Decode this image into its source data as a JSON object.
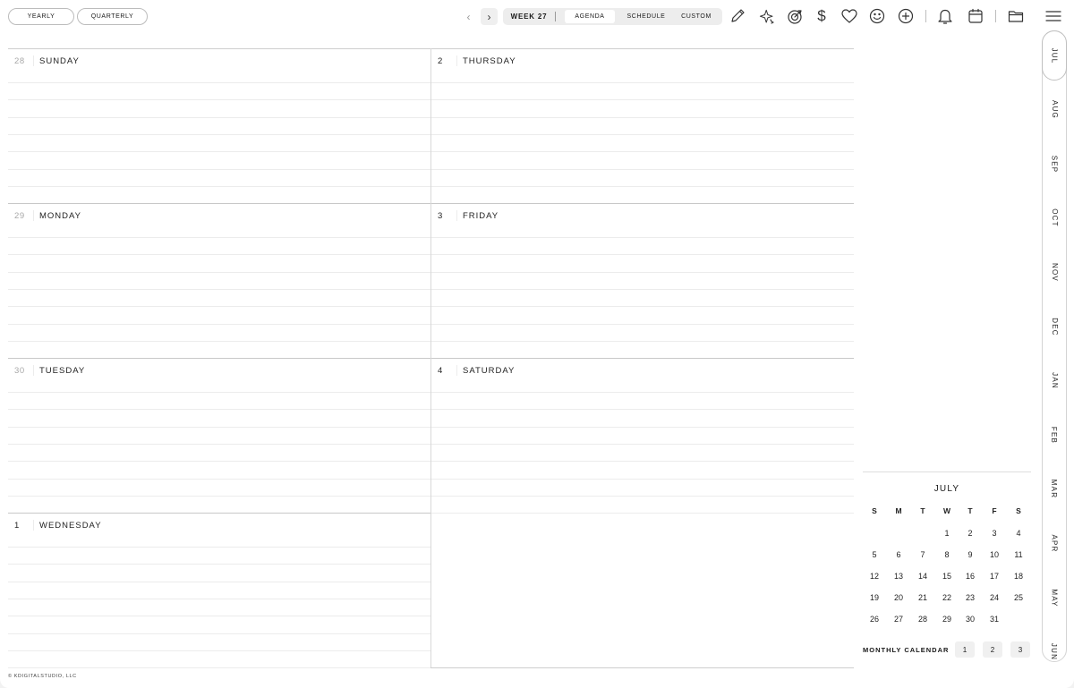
{
  "top_bar": {
    "yearly": "YEARLY",
    "quarterly": "QUARTERLY",
    "prev": "‹",
    "next": "›",
    "week": "WEEK 27",
    "views": [
      "AGENDA",
      "SCHEDULE",
      "CUSTOM"
    ],
    "active_view": "AGENDA",
    "icons": [
      "pencil-icon",
      "sparkle-icon",
      "target-icon",
      "dollar-icon",
      "heart-icon",
      "smiley-icon",
      "plus-circle-icon",
      "bell-icon",
      "calendar-icon",
      "folder-icon",
      "menu-icon"
    ],
    "dollar_glyph": "$"
  },
  "days": [
    {
      "num": "28",
      "name": "SUNDAY",
      "muted": true
    },
    {
      "num": "29",
      "name": "MONDAY",
      "muted": true
    },
    {
      "num": "30",
      "name": "TUESDAY",
      "muted": true
    },
    {
      "num": "1",
      "name": "WEDNESDAY",
      "muted": false
    },
    {
      "num": "2",
      "name": "THURSDAY",
      "muted": false
    },
    {
      "num": "3",
      "name": "FRIDAY",
      "muted": false
    },
    {
      "num": "4",
      "name": "SATURDAY",
      "muted": false
    }
  ],
  "months": [
    "JUL",
    "AUG",
    "SEP",
    "OCT",
    "NOV",
    "DEC",
    "JAN",
    "FEB",
    "MAR",
    "APR",
    "MAY",
    "JUN"
  ],
  "active_month": "JUL",
  "mini_calendar": {
    "title": "JULY",
    "weekdays": [
      "S",
      "M",
      "T",
      "W",
      "T",
      "F",
      "S"
    ],
    "weeks": [
      [
        "",
        "",
        "",
        "1",
        "2",
        "3",
        "4"
      ],
      [
        "5",
        "6",
        "7",
        "8",
        "9",
        "10",
        "11"
      ],
      [
        "12",
        "13",
        "14",
        "15",
        "16",
        "17",
        "18"
      ],
      [
        "19",
        "20",
        "21",
        "22",
        "23",
        "24",
        "25"
      ],
      [
        "26",
        "27",
        "28",
        "29",
        "30",
        "31",
        ""
      ]
    ]
  },
  "monthly_calendar": {
    "label": "MONTHLY CALENDAR",
    "buttons": [
      "1",
      "2",
      "3"
    ]
  },
  "footer": "© KDIGITALSTUDIO, LLC"
}
